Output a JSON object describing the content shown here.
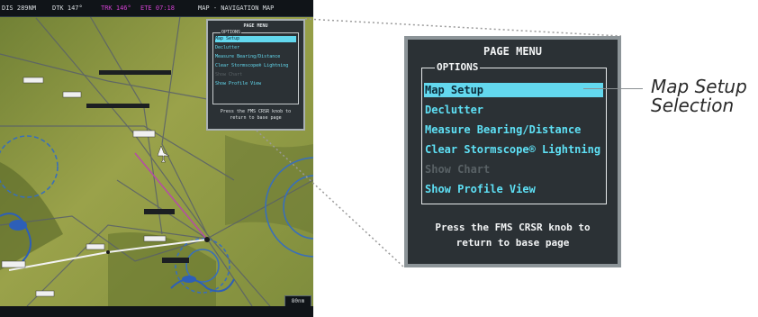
{
  "top_bar": {
    "dis": "DIS 289NM",
    "dtk": "DTK 147°",
    "trk": "TRK 146°",
    "ete": "ETE 07:18",
    "title": "MAP - NAVIGATION MAP"
  },
  "map": {
    "range": "80nm"
  },
  "page_menu": {
    "title": "PAGE MENU",
    "options_label": "OPTIONS",
    "items": [
      {
        "label": "Map Setup",
        "state": "selected"
      },
      {
        "label": "Declutter",
        "state": "normal"
      },
      {
        "label": "Measure Bearing/Distance",
        "state": "normal"
      },
      {
        "label": "Clear Stormscope® Lightning",
        "state": "normal"
      },
      {
        "label": "Show Chart",
        "state": "disabled"
      },
      {
        "label": "Show Profile View",
        "state": "normal"
      }
    ],
    "hint_line1": "Press the FMS CRSR knob to",
    "hint_line2": "return to base page"
  },
  "mini_menu": {
    "title": "PAGE MENU",
    "options_label": "OPTIONS",
    "items": [
      "Map Setup",
      "Declutter",
      "Measure Bearing/Distance",
      "Clear Stormscope® Lightning",
      "Show Chart",
      "Show Profile View"
    ],
    "hint_line1": "Press the FMS CRSR knob to",
    "hint_line2": "return to base page"
  },
  "callout": {
    "line1": "Map Setup",
    "line2": "Selection"
  },
  "colors": {
    "menu_bg": "#2b3135",
    "menu_item": "#5ee0f5",
    "selection": "#63d8ee",
    "map_terrain": "#8a9440"
  }
}
